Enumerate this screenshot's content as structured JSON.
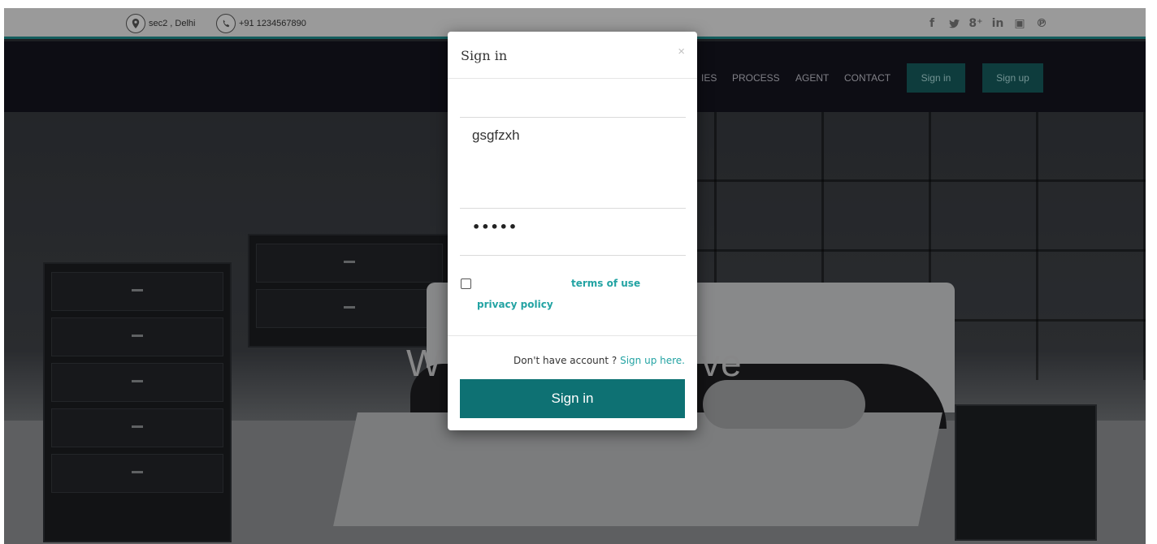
{
  "topbar": {
    "location_text": "sec2 , Delhi",
    "phone_text": "+91 1234567890",
    "social_icons": [
      "facebook-icon",
      "twitter-icon",
      "google-plus-icon",
      "linkedin-icon",
      "flickr-icon",
      "pinterest-icon"
    ],
    "social_glyphs": [
      "f",
      "🐦",
      "8⁺",
      "in",
      "▣",
      "℗"
    ]
  },
  "navbar": {
    "links": [
      "IES",
      "PROCESS",
      "AGENT",
      "CONTACT"
    ],
    "signin_label": "Sign in",
    "signup_label": "Sign up"
  },
  "hero": {
    "title_left": "W",
    "title_right": "ve"
  },
  "modal": {
    "title": "Sign in",
    "close_glyph": "×",
    "email_value": "gsgfzxh",
    "password_value": "•••••",
    "terms_link": "terms of use",
    "privacy_link": "privacy policy",
    "no_account_text": "Don't have account ?",
    "signup_here_link": "Sign up here.",
    "submit_label": "Sign in"
  },
  "colors": {
    "accent": "#0e7173",
    "link": "#23a3a3",
    "navbar_bg": "#14141e",
    "topbar_border": "#1e8a89"
  }
}
